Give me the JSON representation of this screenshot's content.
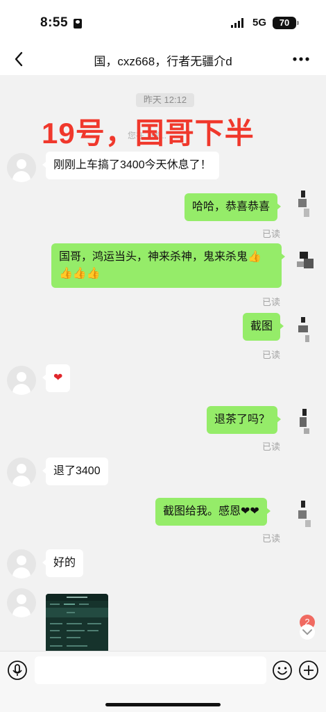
{
  "status_bar": {
    "time": "8:55",
    "network": "5G",
    "battery": "70"
  },
  "header": {
    "title": "国，cxz668，行者无疆介d"
  },
  "chat": {
    "time_divider": "昨天 12:12",
    "overlay_caption": "19号，国哥下半",
    "system_hint": "您在...截...",
    "messages": [
      {
        "side": "left",
        "text": "刚刚上车搞了3400今天休息了！"
      },
      {
        "side": "right",
        "text": "哈哈，恭喜恭喜",
        "status": "已读"
      },
      {
        "side": "right",
        "text_line1": "国哥，鸿运当头，神来杀神，鬼来杀鬼👍",
        "text_line2": "👍👍👍",
        "status": "已读"
      },
      {
        "side": "right",
        "text": "截图",
        "status": "已读"
      },
      {
        "side": "left",
        "text": "❤"
      },
      {
        "side": "right",
        "text": "退茶了吗？",
        "status": "已读"
      },
      {
        "side": "left",
        "text": "退了3400"
      },
      {
        "side": "right",
        "text": "截图给我。感恩❤❤",
        "status": "已读"
      },
      {
        "side": "left",
        "text": "好的"
      }
    ]
  },
  "unread_count": "2",
  "input_bar": {
    "placeholder": ""
  },
  "icons": {
    "back": "chevron-left-icon",
    "more": "more-dots-icon",
    "voice": "voice-icon",
    "emoji": "emoji-icon",
    "plus": "plus-icon"
  },
  "colors": {
    "self_bubble": "#95ec69",
    "other_bubble": "#ffffff",
    "caption": "#f0382c",
    "badge": "#f06a61"
  }
}
